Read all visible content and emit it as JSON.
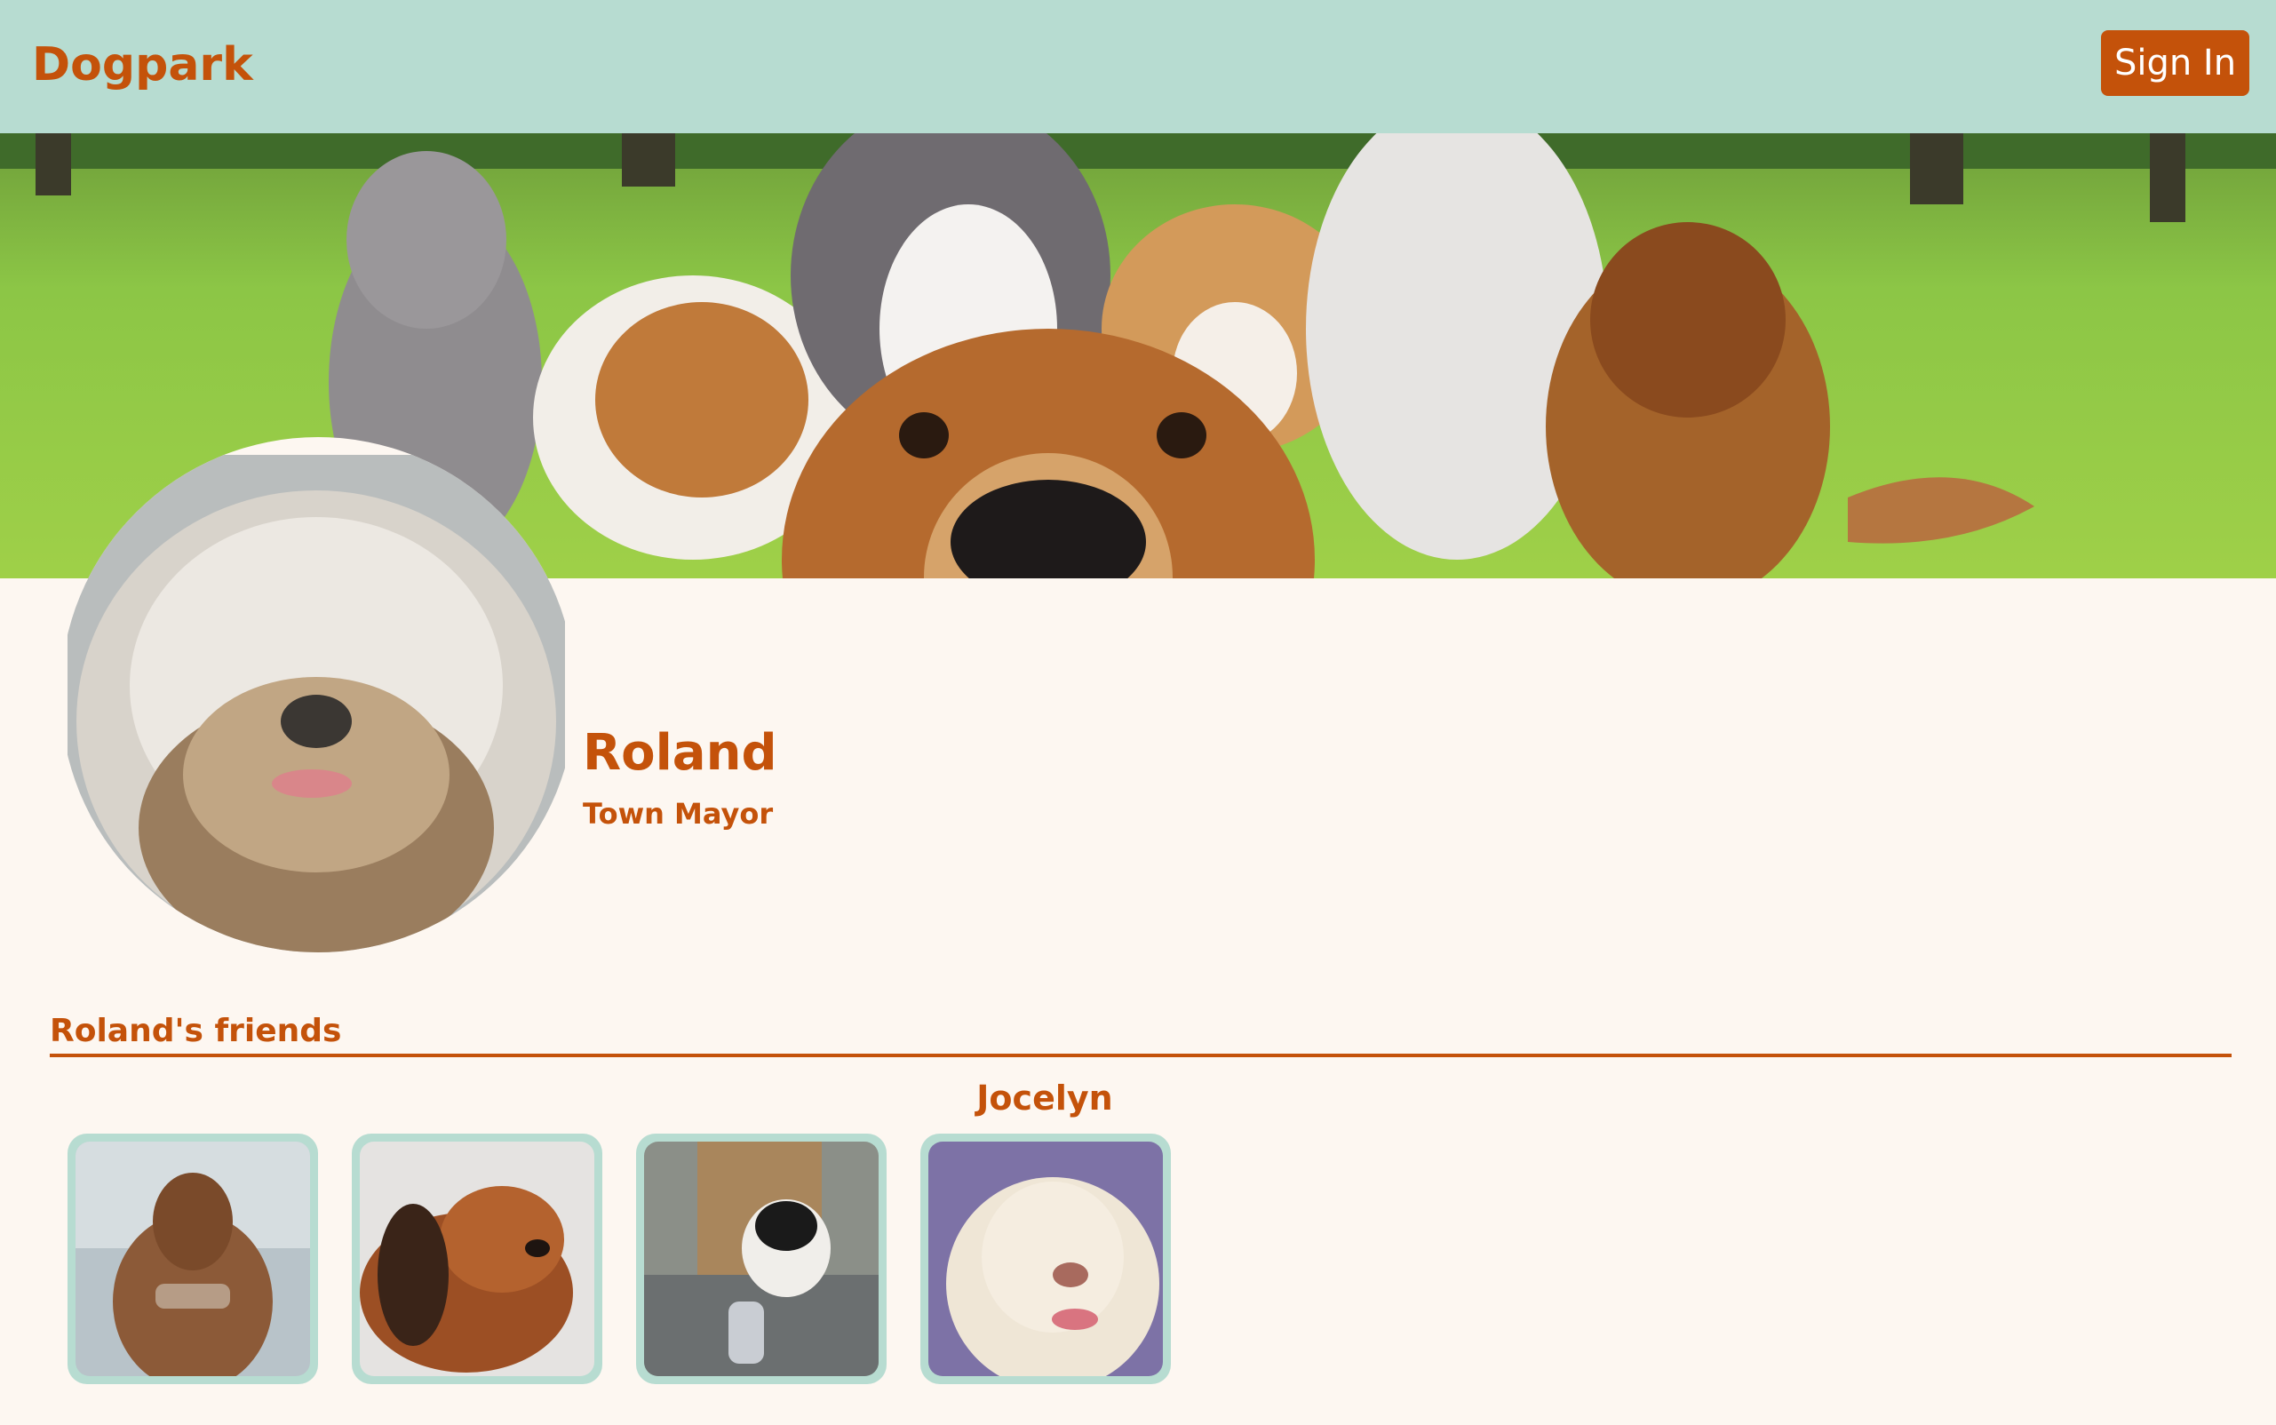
{
  "header": {
    "brand": "Dogpark",
    "sign_in_label": "Sign In"
  },
  "profile": {
    "name": "Roland",
    "title": "Town Mayor"
  },
  "friends": {
    "heading": "Roland's friends",
    "hovered_name": "Jocelyn",
    "items": [
      {
        "icon": "dog-photo-long-haired-dachshund"
      },
      {
        "icon": "dog-photo-dachshund-lying"
      },
      {
        "icon": "dog-photo-black-white-puppy"
      },
      {
        "icon": "dog-photo-yellow-labrador"
      }
    ]
  },
  "colors": {
    "accent": "#c4520a",
    "nav_background": "#b7dcd1",
    "page_background": "#fdf7f1"
  }
}
